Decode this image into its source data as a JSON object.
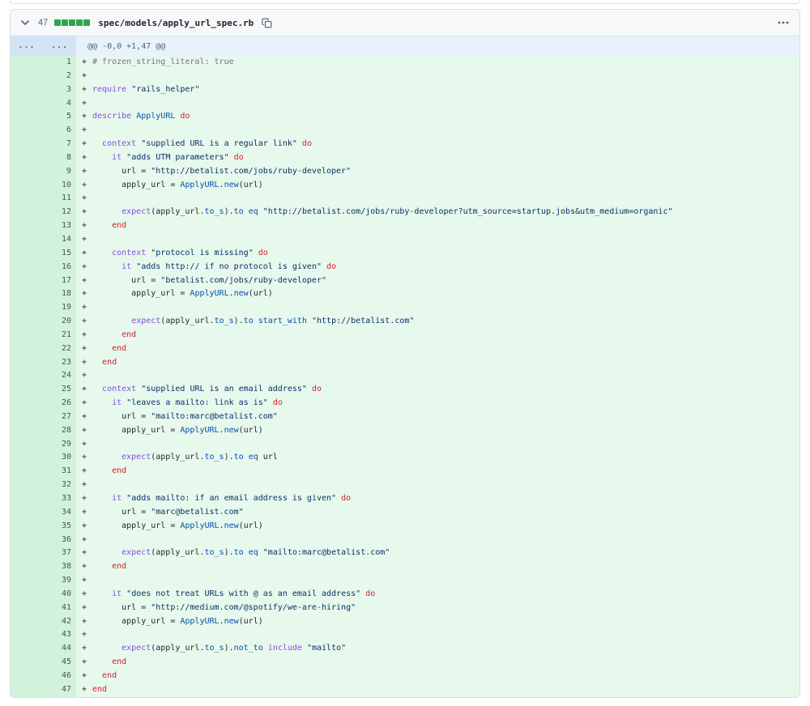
{
  "file_header": {
    "changes_count": "47",
    "diffstat_blocks": 5,
    "filename": "spec/models/apply_url_spec.rb"
  },
  "hunk": {
    "old_expand_label": "...",
    "new_expand_label": "...",
    "header_text": "@@ -0,0 +1,47 @@"
  },
  "colors": {
    "addition_row_bg": "#e7f8ec",
    "addition_gutter_bg": "#d3f2dc",
    "hunk_row_bg": "#e9f2fb",
    "hunk_gutter_bg": "#d2e4f6",
    "diffstat_green": "#2da44e",
    "syntax": {
      "plain": "#24292f",
      "kw": "#cf222e",
      "str": "#0a3069",
      "meth": "#8250df",
      "const": "#0550ae",
      "com": "#6e7781"
    }
  },
  "diff": {
    "marker": "+",
    "lines": [
      {
        "num": 1,
        "tokens": [
          [
            "com",
            "# frozen_string_literal: true"
          ]
        ]
      },
      {
        "num": 2,
        "tokens": []
      },
      {
        "num": 3,
        "tokens": [
          [
            "meth",
            "require"
          ],
          [
            "plain",
            " "
          ],
          [
            "str",
            "\"rails_helper\""
          ]
        ]
      },
      {
        "num": 4,
        "tokens": []
      },
      {
        "num": 5,
        "tokens": [
          [
            "meth",
            "describe"
          ],
          [
            "plain",
            " "
          ],
          [
            "const",
            "ApplyURL"
          ],
          [
            "plain",
            " "
          ],
          [
            "kw",
            "do"
          ]
        ]
      },
      {
        "num": 6,
        "tokens": []
      },
      {
        "num": 7,
        "tokens": [
          [
            "plain",
            "  "
          ],
          [
            "meth",
            "context"
          ],
          [
            "plain",
            " "
          ],
          [
            "str",
            "\"supplied URL is a regular link\""
          ],
          [
            "plain",
            " "
          ],
          [
            "kw",
            "do"
          ]
        ]
      },
      {
        "num": 8,
        "tokens": [
          [
            "plain",
            "    "
          ],
          [
            "meth",
            "it"
          ],
          [
            "plain",
            " "
          ],
          [
            "str",
            "\"adds UTM parameters\""
          ],
          [
            "plain",
            " "
          ],
          [
            "kw",
            "do"
          ]
        ]
      },
      {
        "num": 9,
        "tokens": [
          [
            "plain",
            "      url = "
          ],
          [
            "str",
            "\"http://betalist.com/jobs/ruby-developer\""
          ]
        ]
      },
      {
        "num": 10,
        "tokens": [
          [
            "plain",
            "      apply_url = "
          ],
          [
            "const",
            "ApplyURL"
          ],
          [
            "plain",
            "."
          ],
          [
            "const",
            "new"
          ],
          [
            "plain",
            "(url)"
          ]
        ]
      },
      {
        "num": 11,
        "tokens": []
      },
      {
        "num": 12,
        "tokens": [
          [
            "plain",
            "      "
          ],
          [
            "meth",
            "expect"
          ],
          [
            "plain",
            "(apply_url."
          ],
          [
            "const",
            "to_s"
          ],
          [
            "plain",
            ")."
          ],
          [
            "const",
            "to"
          ],
          [
            "plain",
            " "
          ],
          [
            "const",
            "eq"
          ],
          [
            "plain",
            " "
          ],
          [
            "str",
            "\"http://betalist.com/jobs/ruby-developer?utm_source=startup.jobs&utm_medium=organic\""
          ]
        ]
      },
      {
        "num": 13,
        "tokens": [
          [
            "plain",
            "    "
          ],
          [
            "kw",
            "end"
          ]
        ]
      },
      {
        "num": 14,
        "tokens": []
      },
      {
        "num": 15,
        "tokens": [
          [
            "plain",
            "    "
          ],
          [
            "meth",
            "context"
          ],
          [
            "plain",
            " "
          ],
          [
            "str",
            "\"protocol is missing\""
          ],
          [
            "plain",
            " "
          ],
          [
            "kw",
            "do"
          ]
        ]
      },
      {
        "num": 16,
        "tokens": [
          [
            "plain",
            "      "
          ],
          [
            "meth",
            "it"
          ],
          [
            "plain",
            " "
          ],
          [
            "str",
            "\"adds http:// if no protocol is given\""
          ],
          [
            "plain",
            " "
          ],
          [
            "kw",
            "do"
          ]
        ]
      },
      {
        "num": 17,
        "tokens": [
          [
            "plain",
            "        url = "
          ],
          [
            "str",
            "\"betalist.com/jobs/ruby-developer\""
          ]
        ]
      },
      {
        "num": 18,
        "tokens": [
          [
            "plain",
            "        apply_url = "
          ],
          [
            "const",
            "ApplyURL"
          ],
          [
            "plain",
            "."
          ],
          [
            "const",
            "new"
          ],
          [
            "plain",
            "(url)"
          ]
        ]
      },
      {
        "num": 19,
        "tokens": []
      },
      {
        "num": 20,
        "tokens": [
          [
            "plain",
            "        "
          ],
          [
            "meth",
            "expect"
          ],
          [
            "plain",
            "(apply_url."
          ],
          [
            "const",
            "to_s"
          ],
          [
            "plain",
            ")."
          ],
          [
            "const",
            "to"
          ],
          [
            "plain",
            " "
          ],
          [
            "const",
            "start_with"
          ],
          [
            "plain",
            " "
          ],
          [
            "str",
            "\"http://betalist.com\""
          ]
        ]
      },
      {
        "num": 21,
        "tokens": [
          [
            "plain",
            "      "
          ],
          [
            "kw",
            "end"
          ]
        ]
      },
      {
        "num": 22,
        "tokens": [
          [
            "plain",
            "    "
          ],
          [
            "kw",
            "end"
          ]
        ]
      },
      {
        "num": 23,
        "tokens": [
          [
            "plain",
            "  "
          ],
          [
            "kw",
            "end"
          ]
        ]
      },
      {
        "num": 24,
        "tokens": []
      },
      {
        "num": 25,
        "tokens": [
          [
            "plain",
            "  "
          ],
          [
            "meth",
            "context"
          ],
          [
            "plain",
            " "
          ],
          [
            "str",
            "\"supplied URL is an email address\""
          ],
          [
            "plain",
            " "
          ],
          [
            "kw",
            "do"
          ]
        ]
      },
      {
        "num": 26,
        "tokens": [
          [
            "plain",
            "    "
          ],
          [
            "meth",
            "it"
          ],
          [
            "plain",
            " "
          ],
          [
            "str",
            "\"leaves a mailto: link as is\""
          ],
          [
            "plain",
            " "
          ],
          [
            "kw",
            "do"
          ]
        ]
      },
      {
        "num": 27,
        "tokens": [
          [
            "plain",
            "      url = "
          ],
          [
            "str",
            "\"mailto:marc@betalist.com\""
          ]
        ]
      },
      {
        "num": 28,
        "tokens": [
          [
            "plain",
            "      apply_url = "
          ],
          [
            "const",
            "ApplyURL"
          ],
          [
            "plain",
            "."
          ],
          [
            "const",
            "new"
          ],
          [
            "plain",
            "(url)"
          ]
        ]
      },
      {
        "num": 29,
        "tokens": []
      },
      {
        "num": 30,
        "tokens": [
          [
            "plain",
            "      "
          ],
          [
            "meth",
            "expect"
          ],
          [
            "plain",
            "(apply_url."
          ],
          [
            "const",
            "to_s"
          ],
          [
            "plain",
            ")."
          ],
          [
            "const",
            "to"
          ],
          [
            "plain",
            " "
          ],
          [
            "const",
            "eq"
          ],
          [
            "plain",
            " url"
          ]
        ]
      },
      {
        "num": 31,
        "tokens": [
          [
            "plain",
            "    "
          ],
          [
            "kw",
            "end"
          ]
        ]
      },
      {
        "num": 32,
        "tokens": []
      },
      {
        "num": 33,
        "tokens": [
          [
            "plain",
            "    "
          ],
          [
            "meth",
            "it"
          ],
          [
            "plain",
            " "
          ],
          [
            "str",
            "\"adds mailto: if an email address is given\""
          ],
          [
            "plain",
            " "
          ],
          [
            "kw",
            "do"
          ]
        ]
      },
      {
        "num": 34,
        "tokens": [
          [
            "plain",
            "      url = "
          ],
          [
            "str",
            "\"marc@betalist.com\""
          ]
        ]
      },
      {
        "num": 35,
        "tokens": [
          [
            "plain",
            "      apply_url = "
          ],
          [
            "const",
            "ApplyURL"
          ],
          [
            "plain",
            "."
          ],
          [
            "const",
            "new"
          ],
          [
            "plain",
            "(url)"
          ]
        ]
      },
      {
        "num": 36,
        "tokens": []
      },
      {
        "num": 37,
        "tokens": [
          [
            "plain",
            "      "
          ],
          [
            "meth",
            "expect"
          ],
          [
            "plain",
            "(apply_url."
          ],
          [
            "const",
            "to_s"
          ],
          [
            "plain",
            ")."
          ],
          [
            "const",
            "to"
          ],
          [
            "plain",
            " "
          ],
          [
            "const",
            "eq"
          ],
          [
            "plain",
            " "
          ],
          [
            "str",
            "\"mailto:marc@betalist.com\""
          ]
        ]
      },
      {
        "num": 38,
        "tokens": [
          [
            "plain",
            "    "
          ],
          [
            "kw",
            "end"
          ]
        ]
      },
      {
        "num": 39,
        "tokens": []
      },
      {
        "num": 40,
        "tokens": [
          [
            "plain",
            "    "
          ],
          [
            "meth",
            "it"
          ],
          [
            "plain",
            " "
          ],
          [
            "str",
            "\"does not treat URLs with @ as an email address\""
          ],
          [
            "plain",
            " "
          ],
          [
            "kw",
            "do"
          ]
        ]
      },
      {
        "num": 41,
        "tokens": [
          [
            "plain",
            "      url = "
          ],
          [
            "str",
            "\"http://medium.com/@spotify/we-are-hiring\""
          ]
        ]
      },
      {
        "num": 42,
        "tokens": [
          [
            "plain",
            "      apply_url = "
          ],
          [
            "const",
            "ApplyURL"
          ],
          [
            "plain",
            "."
          ],
          [
            "const",
            "new"
          ],
          [
            "plain",
            "(url)"
          ]
        ]
      },
      {
        "num": 43,
        "tokens": []
      },
      {
        "num": 44,
        "tokens": [
          [
            "plain",
            "      "
          ],
          [
            "meth",
            "expect"
          ],
          [
            "plain",
            "(apply_url."
          ],
          [
            "const",
            "to_s"
          ],
          [
            "plain",
            ")."
          ],
          [
            "const",
            "not_to"
          ],
          [
            "plain",
            " "
          ],
          [
            "meth",
            "include"
          ],
          [
            "plain",
            " "
          ],
          [
            "str",
            "\"mailto\""
          ]
        ]
      },
      {
        "num": 45,
        "tokens": [
          [
            "plain",
            "    "
          ],
          [
            "kw",
            "end"
          ]
        ]
      },
      {
        "num": 46,
        "tokens": [
          [
            "plain",
            "  "
          ],
          [
            "kw",
            "end"
          ]
        ]
      },
      {
        "num": 47,
        "tokens": [
          [
            "kw",
            "end"
          ]
        ]
      }
    ]
  }
}
